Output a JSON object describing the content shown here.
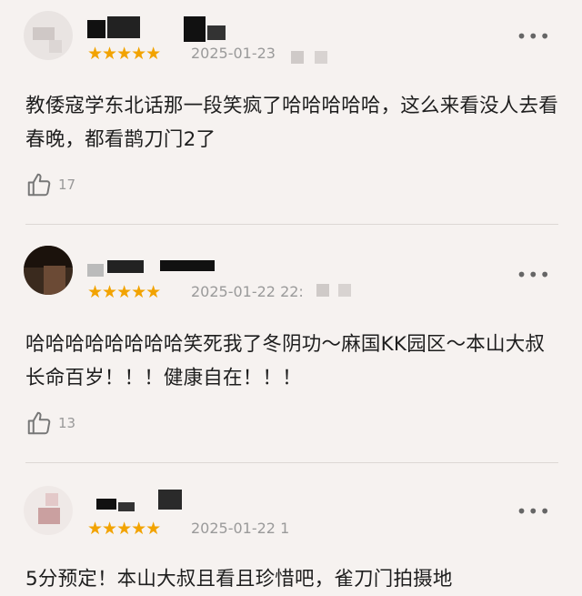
{
  "reviews": [
    {
      "stars": "★★★★★",
      "date": "2025-01-23",
      "content": "教倭寇学东北话那一段笑疯了哈哈哈哈哈，这么来看没人去看春晚，都看鹊刀门2了",
      "likes": "17"
    },
    {
      "stars": "★★★★★",
      "date": "2025-01-22 22:",
      "content": "哈哈哈哈哈哈哈哈笑死我了冬阴功～麻国KK园区～本山大叔长命百岁！！！健康自在！！！",
      "likes": "13"
    },
    {
      "stars": "★★★★★",
      "date": "2025-01-22 1",
      "content": "5分预定！本山大叔且看且珍惜吧，雀刀门拍摄地",
      "likes": ""
    }
  ],
  "icons": {
    "more": "more-icon",
    "like": "thumbs-up-icon"
  },
  "colors": {
    "star": "#f2a300",
    "background": "#f6f2f0",
    "muted": "#9a9a9a"
  }
}
